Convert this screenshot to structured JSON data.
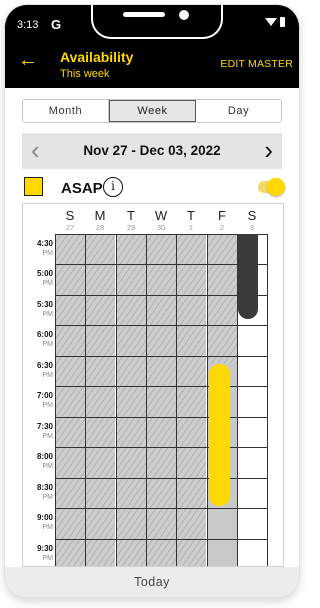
{
  "status": {
    "time": "3:13",
    "carrier_icon": "G"
  },
  "header": {
    "back_icon": "arrow-left-icon",
    "title": "Availability",
    "subtitle": "This week",
    "action": "EDIT MASTER"
  },
  "view_tabs": {
    "items": [
      "Month",
      "Week",
      "Day"
    ],
    "selected": "Week"
  },
  "date_nav": {
    "range": "Nov 27 - Dec 03, 2022",
    "prev_icon": "chevron-left-icon",
    "next_icon": "chevron-right-icon"
  },
  "availability": {
    "label": "ASAP",
    "info_icon": "i",
    "toggle_on": true,
    "swatch_color": "#ffd800"
  },
  "calendar": {
    "days": [
      {
        "letter": "S",
        "date": "27"
      },
      {
        "letter": "M",
        "date": "28"
      },
      {
        "letter": "T",
        "date": "29"
      },
      {
        "letter": "W",
        "date": "30"
      },
      {
        "letter": "T",
        "date": "1"
      },
      {
        "letter": "F",
        "date": "2"
      },
      {
        "letter": "S",
        "date": "3"
      }
    ],
    "times": [
      {
        "time": "4:30",
        "ampm": "PM"
      },
      {
        "time": "5:00",
        "ampm": "PM"
      },
      {
        "time": "5:30",
        "ampm": "PM"
      },
      {
        "time": "6:00",
        "ampm": "PM"
      },
      {
        "time": "6:30",
        "ampm": "PM"
      },
      {
        "time": "7:00",
        "ampm": "PM"
      },
      {
        "time": "7:30",
        "ampm": "PM"
      },
      {
        "time": "8:00",
        "ampm": "PM"
      },
      {
        "time": "8:30",
        "ampm": "PM"
      },
      {
        "time": "9:00",
        "ampm": "PM"
      },
      {
        "time": "9:30",
        "ampm": "PM"
      }
    ],
    "colors": {
      "asap": "#ffd800",
      "master": "#3a3a3a",
      "past": "#cdcdcd"
    }
  },
  "footer": {
    "today_label": "Today"
  }
}
